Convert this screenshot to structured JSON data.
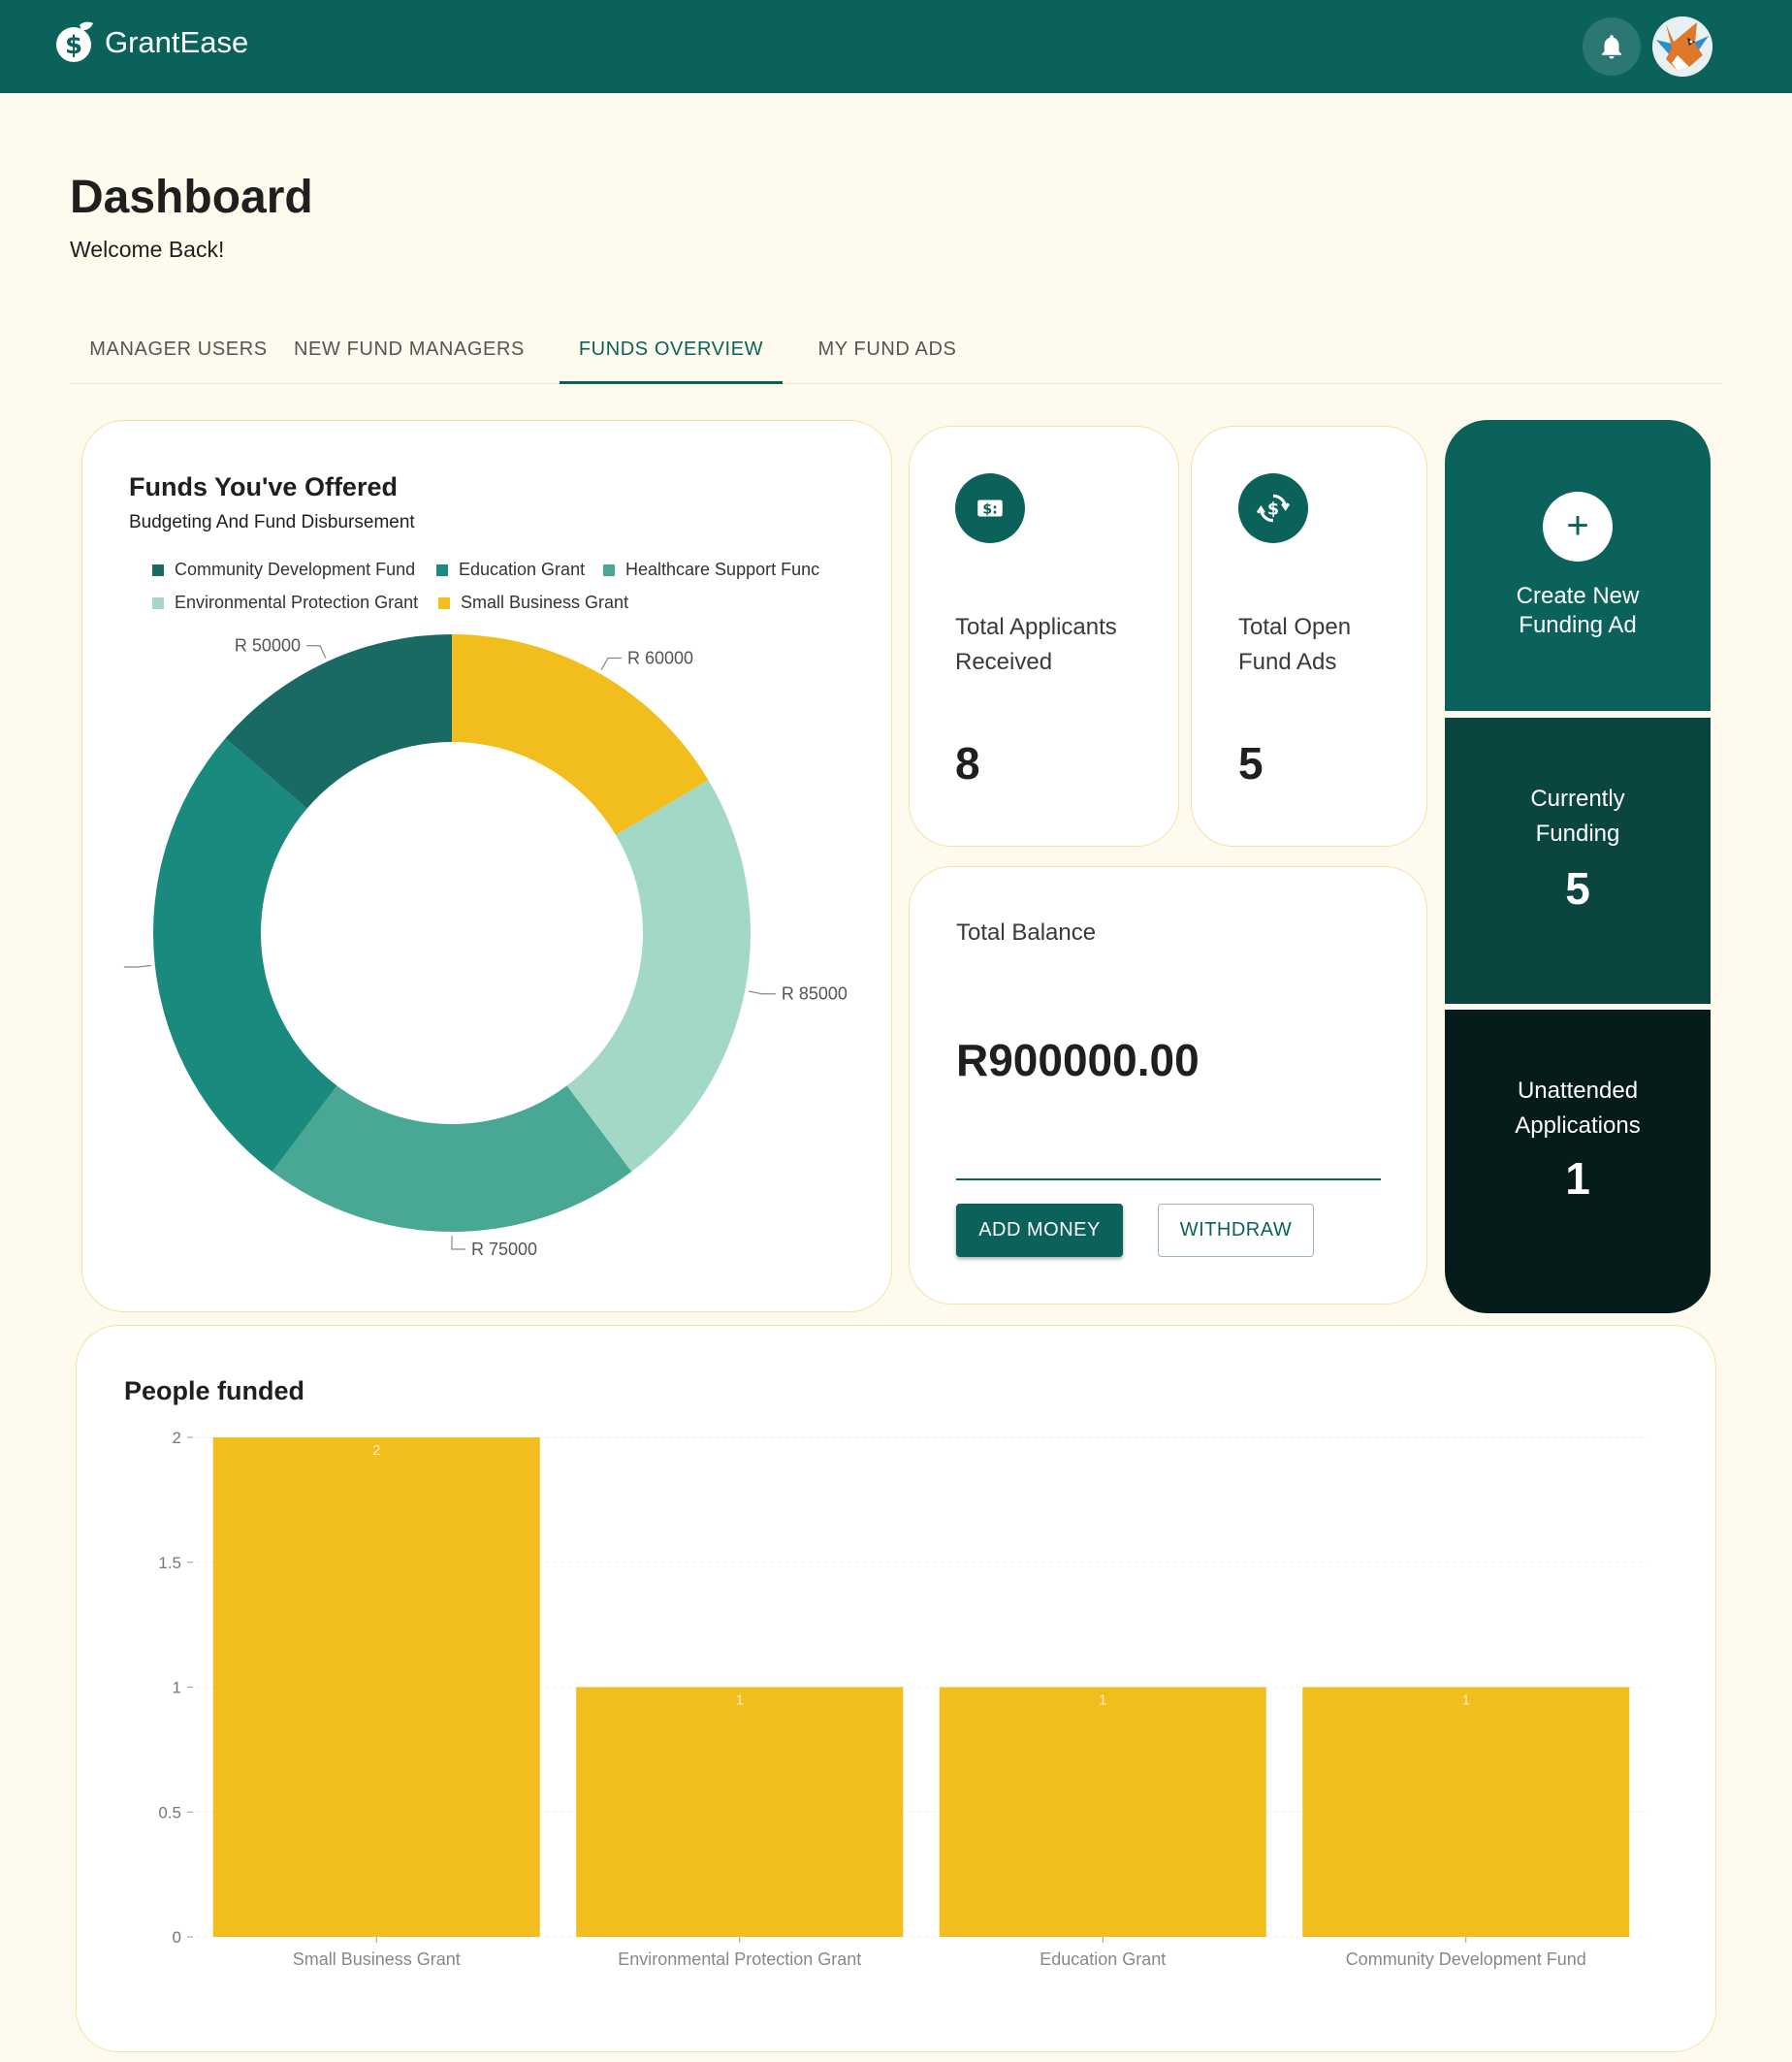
{
  "app": {
    "name": "GrantEase"
  },
  "page": {
    "title": "Dashboard",
    "subtitle": "Welcome Back!"
  },
  "tabs": [
    {
      "label": "MANAGER USERS",
      "active": false
    },
    {
      "label": "NEW FUND MANAGERS",
      "active": false
    },
    {
      "label": "FUNDS OVERVIEW",
      "active": true
    },
    {
      "label": "MY FUND ADS",
      "active": false
    }
  ],
  "funds_card": {
    "title": "Funds You've Offered",
    "subtitle": "Budgeting And Fund Disbursement"
  },
  "stats": {
    "applicants": {
      "label_line1": "Total Applicants",
      "label_line2": "Received",
      "value": "8",
      "icon": "money-icon"
    },
    "open_ads": {
      "label_line1": "Total Open",
      "label_line2": "Fund Ads",
      "value": "5",
      "icon": "currency-exchange-icon"
    }
  },
  "balance": {
    "label": "Total Balance",
    "value": "R900000.00",
    "add_label": "ADD MONEY",
    "withdraw_label": "WITHDRAW"
  },
  "side": {
    "create": {
      "plus": "+",
      "line1": "Create New",
      "line2": "Funding Ad"
    },
    "funding": {
      "line1": "Currently",
      "line2": "Funding",
      "value": "5"
    },
    "unattended": {
      "line1": "Unattended",
      "line2": "Applications",
      "value": "1"
    }
  },
  "people_card": {
    "title": "People funded"
  },
  "colors": {
    "primary": "#0b625a",
    "accent_yellow": "#f2be1d",
    "background": "#fefaee"
  },
  "chart_data": [
    {
      "type": "pie",
      "variant": "donut",
      "categories": [
        "Community Development Fund",
        "Education Grant",
        "Healthcare Support Fund",
        "Environmental Protection Grant",
        "Small Business Grant"
      ],
      "values": [
        50000,
        95000,
        75000,
        85000,
        60000
      ],
      "data_labels": [
        "R 50000",
        "",
        "R 75000",
        "R 85000",
        "R 60000"
      ],
      "colors": [
        "#186a63",
        "#1b8a7e",
        "#48a895",
        "#a3d8c6",
        "#f2be1d"
      ],
      "legend": "top",
      "title": "",
      "legend_labels": [
        "Community Development Fund",
        "Education Grant",
        "Healthcare Support Func",
        "Environmental Protection Grant",
        "Small Business Grant"
      ]
    },
    {
      "type": "bar",
      "categories": [
        "Small Business Grant",
        "Environmental Protection Grant",
        "Education Grant",
        "Community Development Fund"
      ],
      "values": [
        2,
        1,
        1,
        1
      ],
      "data_labels": [
        "2",
        "1",
        "1",
        "1"
      ],
      "color": "#f2be1d",
      "ylim": [
        0,
        2
      ],
      "yticks": [
        "0",
        "0.5",
        "1",
        "1.5",
        "2"
      ],
      "grid": true,
      "title": "",
      "xlabel": "",
      "ylabel": ""
    }
  ]
}
